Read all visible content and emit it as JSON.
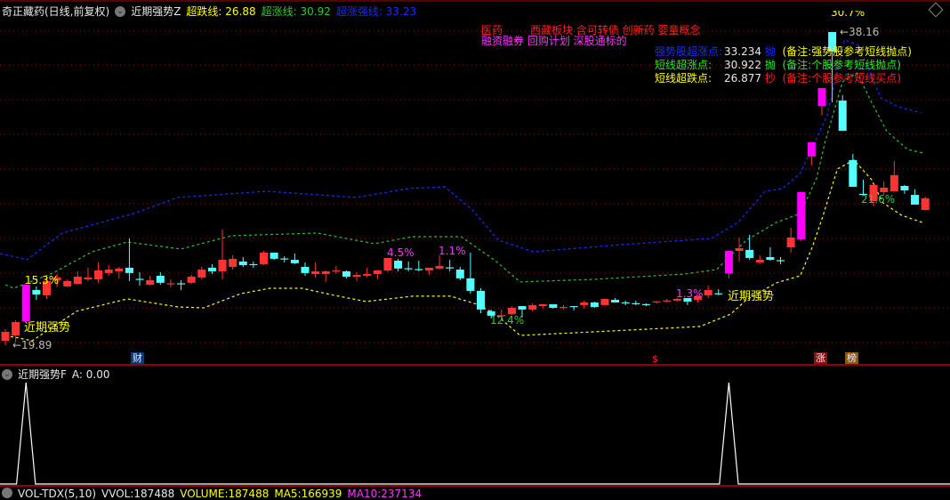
{
  "header": {
    "stock_title": "奇正藏药(日线,前复权)",
    "indicator_name": "近期强势Z",
    "lines": [
      {
        "label": "超跌线:",
        "value": "26.88",
        "color": "#ffff00"
      },
      {
        "label": "超涨线:",
        "value": "30.92",
        "color": "#2ecc2e"
      },
      {
        "label": "超涨强线:",
        "value": "33.23",
        "color": "#1a2cff"
      }
    ]
  },
  "concepts": {
    "line1a": "医药",
    "line1b": "西藏板块 含可转债 创新药 婴童概念",
    "line2": "融资融券 回购计划 深股通标的"
  },
  "legend": [
    {
      "label": "强势股超涨点:",
      "value": "33.234",
      "action": "抛",
      "note": "(备注:强势股参考短线抛点)",
      "label_color": "#1a2cff",
      "action_color": "#1a2cff",
      "note_color": "#ffff00"
    },
    {
      "label": "短线超涨点:",
      "value": "30.922",
      "action": "抛",
      "note": "(备注:个股参考短线抛点)",
      "label_color": "#22ee22",
      "action_color": "#22ee22",
      "note_color": "#22ee22"
    },
    {
      "label": "短线超跌点:",
      "value": "26.877",
      "action": "抄",
      "note": "(备注:个股参考短线买点)",
      "label_color": "#ffff00",
      "action_color": "#ff2020",
      "note_color": "#ff2020"
    }
  ],
  "annotations": {
    "low_price": "←19.89",
    "high_price": "←38.16",
    "pct_15": "15.3%",
    "pct_45": "4.5%",
    "pct_11": "1.1%",
    "pct_124": "12.4%",
    "pct_13": "1.3%",
    "pct_216": "21.6%",
    "pct_307": "30.7%",
    "signal1": "近期强势",
    "signal2": "近期强势"
  },
  "markers": {
    "cai": "财",
    "dollar": "$",
    "zhang": "涨",
    "bang": "榜"
  },
  "lower_pane": {
    "title": "近期强势F",
    "value_text": "A: 0.00"
  },
  "volume_pane": {
    "name": "VOL-TDX(5,10)",
    "vvol": "VVOL:187488",
    "volume": "VOLUME:187488",
    "ma5": "MA5:166939",
    "ma10": "MA10:237134"
  },
  "colors": {
    "up": "#ff3333",
    "down": "#54ffff",
    "strong": "#ff00ff",
    "grid": "#b00000"
  },
  "chart_data": {
    "type": "candlestick",
    "price_range": [
      19.89,
      38.16
    ],
    "candles": [
      [
        20.15,
        20.83,
        19.89,
        20.67
      ],
      [
        20.46,
        21.35,
        20.05,
        21.24
      ],
      [
        21.29,
        23.42,
        21.29,
        23.42,
        "s"
      ],
      [
        23.11,
        23.32,
        22.54,
        22.85
      ],
      [
        22.8,
        23.84,
        22.59,
        23.63
      ],
      [
        23.68,
        24.04,
        23.27,
        23.84
      ],
      [
        23.32,
        23.73,
        23.27,
        23.63
      ],
      [
        23.47,
        24.2,
        23.47,
        23.89
      ],
      [
        23.73,
        24.41,
        23.63,
        23.84
      ],
      [
        23.73,
        24.72,
        23.53,
        24.25
      ],
      [
        24.1,
        24.56,
        23.94,
        24.3
      ],
      [
        24.2,
        24.46,
        23.78,
        24.36
      ],
      [
        24.41,
        26.12,
        23.63,
        24.1
      ],
      [
        23.76,
        24.15,
        23.37,
        23.73
      ],
      [
        23.42,
        23.94,
        23.37,
        23.68
      ],
      [
        23.94,
        24.15,
        23.42,
        23.53
      ],
      [
        23.47,
        23.73,
        23.27,
        23.5
      ],
      [
        23.5,
        23.68,
        23.11,
        23.47
      ],
      [
        23.53,
        23.99,
        23.47,
        23.89
      ],
      [
        23.84,
        24.46,
        23.73,
        24.3
      ],
      [
        24.41,
        24.62,
        24.04,
        24.2
      ],
      [
        24.2,
        26.64,
        23.73,
        24.87
      ],
      [
        24.46,
        25.13,
        24.3,
        24.93
      ],
      [
        24.77,
        25.03,
        24.46,
        24.56
      ],
      [
        24.62,
        24.77,
        24.41,
        24.59
      ],
      [
        24.62,
        25.39,
        24.56,
        25.29
      ],
      [
        25.29,
        25.29,
        24.87,
        24.93
      ],
      [
        24.95,
        25.08,
        24.72,
        24.92
      ],
      [
        24.87,
        25.24,
        24.62,
        24.67
      ],
      [
        24.46,
        24.72,
        23.94,
        24.1
      ],
      [
        24.04,
        24.72,
        23.84,
        24.2
      ],
      [
        24.04,
        24.25,
        23.58,
        24.2
      ],
      [
        24.23,
        24.51,
        24.04,
        24.25
      ],
      [
        24.2,
        24.25,
        23.79,
        23.89
      ],
      [
        23.89,
        24.15,
        23.63,
        23.99
      ],
      [
        23.94,
        24.41,
        23.84,
        24.04
      ],
      [
        24.04,
        24.3,
        23.73,
        24.25
      ],
      [
        24.25,
        24.98,
        24.15,
        24.98
      ],
      [
        24.82,
        24.93,
        24.2,
        24.36
      ],
      [
        24.38,
        24.77,
        24.2,
        24.36
      ],
      [
        24.33,
        24.82,
        24.2,
        24.3
      ],
      [
        24.25,
        24.41,
        24.0,
        24.41
      ],
      [
        24.36,
        25.13,
        24.3,
        24.51
      ],
      [
        24.43,
        24.87,
        24.2,
        24.41
      ],
      [
        24.3,
        24.46,
        23.68,
        23.79
      ],
      [
        23.79,
        25.29,
        22.9,
        23.06
      ],
      [
        23.06,
        23.22,
        21.76,
        21.97
      ],
      [
        21.87,
        21.97,
        21.45,
        21.61
      ],
      [
        21.61,
        21.97,
        21.35,
        21.64
      ],
      [
        21.71,
        22.17,
        21.66,
        22.07
      ],
      [
        22.17,
        22.17,
        21.5,
        21.97
      ],
      [
        21.97,
        22.33,
        21.87,
        22.23
      ],
      [
        22.17,
        22.28,
        22.02,
        22.28
      ],
      [
        22.28,
        22.28,
        22.02,
        22.07
      ],
      [
        22.1,
        22.23,
        21.97,
        22.12
      ],
      [
        22.17,
        22.17,
        21.92,
        22.12
      ],
      [
        22.23,
        22.49,
        22.02,
        22.38
      ],
      [
        22.38,
        22.43,
        22.07,
        22.12
      ],
      [
        22.23,
        22.59,
        22.23,
        22.59
      ],
      [
        22.54,
        22.64,
        22.38,
        22.38
      ],
      [
        22.39,
        22.49,
        22.23,
        22.38
      ],
      [
        22.34,
        22.49,
        22.23,
        22.33
      ],
      [
        22.29,
        22.33,
        22.17,
        22.28
      ],
      [
        22.43,
        22.45,
        22.33,
        22.45
      ],
      [
        22.48,
        22.59,
        22.38,
        22.5
      ],
      [
        22.49,
        22.64,
        22.43,
        22.59
      ],
      [
        22.64,
        22.64,
        22.23,
        22.43
      ],
      [
        22.54,
        22.8,
        22.38,
        22.75
      ],
      [
        22.8,
        23.37,
        22.64,
        23.11
      ],
      [
        22.92,
        23.16,
        22.8,
        22.9
      ],
      [
        24.07,
        25.39,
        23.79,
        25.39,
        "s"
      ],
      [
        25.39,
        26.17,
        24.77,
        25.55
      ],
      [
        25.45,
        26.33,
        24.87,
        24.98
      ],
      [
        24.72,
        25.13,
        24.62,
        24.87
      ],
      [
        25.03,
        25.6,
        24.82,
        24.87
      ],
      [
        24.85,
        25.03,
        24.62,
        24.82
      ],
      [
        25.6,
        26.74,
        25.29,
        26.17
      ],
      [
        26.07,
        28.82,
        25.97,
        28.82,
        "s"
      ],
      [
        30.9,
        31.73,
        30.38,
        31.73,
        "s"
      ],
      [
        33.85,
        34.89,
        33.29,
        34.89,
        "s"
      ],
      [
        38.16,
        38.16,
        34.06,
        37.02
      ],
      [
        34.16,
        34.48,
        32.4,
        32.4
      ],
      [
        30.69,
        31.05,
        29.13,
        29.13
      ],
      [
        28.72,
        29.55,
        28.66,
        28.71
      ],
      [
        28.3,
        29.24,
        27.99,
        29.24
      ],
      [
        28.82,
        29.44,
        28.66,
        29.08
      ],
      [
        28.87,
        30.64,
        28.87,
        29.81
      ],
      [
        29.18,
        29.24,
        28.72,
        28.92
      ],
      [
        28.66,
        28.98,
        28.09,
        28.09
      ],
      [
        27.78,
        28.56,
        27.73,
        28.46
      ]
    ],
    "bands": {
      "strong_overbought": [
        [
          -0.5,
          25.24
        ],
        [
          2.1,
          24.88
        ],
        [
          5.5,
          26.43
        ],
        [
          12.4,
          27.57
        ],
        [
          16.7,
          28.51
        ],
        [
          25.3,
          28.87
        ],
        [
          33.9,
          28.51
        ],
        [
          39.1,
          29.03
        ],
        [
          42.5,
          29.13
        ],
        [
          45.1,
          27.83
        ],
        [
          47.7,
          26.02
        ],
        [
          51.1,
          25.34
        ],
        [
          59.7,
          25.76
        ],
        [
          68.3,
          26.12
        ],
        [
          70.9,
          27.05
        ],
        [
          73.5,
          28.87
        ],
        [
          75.2,
          29.03
        ],
        [
          76.9,
          29.91
        ],
        [
          79.5,
          33.28
        ],
        [
          81.2,
          37.7
        ],
        [
          82.5,
          37.4
        ],
        [
          84.7,
          34.32
        ],
        [
          86.4,
          33.8
        ],
        [
          88.6,
          33.44
        ]
      ],
      "overbought": [
        [
          0,
          23.42
        ],
        [
          0.8,
          23.21
        ],
        [
          4.6,
          24.1
        ],
        [
          8.4,
          25.34
        ],
        [
          11.8,
          25.91
        ],
        [
          17,
          25.5
        ],
        [
          21.9,
          26.28
        ],
        [
          30.2,
          26.43
        ],
        [
          35.7,
          25.81
        ],
        [
          39.4,
          26.22
        ],
        [
          44.1,
          26.22
        ],
        [
          47.4,
          24.82
        ],
        [
          49.8,
          23.58
        ],
        [
          56.9,
          23.73
        ],
        [
          65.7,
          24.04
        ],
        [
          68.8,
          24.3
        ],
        [
          71.7,
          26.02
        ],
        [
          74.6,
          27.05
        ],
        [
          76.9,
          27.57
        ],
        [
          78.5,
          29.65
        ],
        [
          79.3,
          31.73
        ],
        [
          81,
          35.26
        ],
        [
          82.4,
          35.77
        ],
        [
          83.8,
          34.06
        ],
        [
          85.3,
          32.35
        ],
        [
          87.3,
          31.31
        ],
        [
          88.8,
          31.1
        ]
      ],
      "oversold": [
        [
          0,
          20.46
        ],
        [
          2.6,
          20.15
        ],
        [
          6.9,
          21.87
        ],
        [
          11.8,
          22.59
        ],
        [
          16.7,
          22.12
        ],
        [
          19.2,
          22.07
        ],
        [
          22.8,
          22.9
        ],
        [
          25.6,
          23.21
        ],
        [
          28.7,
          23.21
        ],
        [
          31.8,
          22.8
        ],
        [
          34.9,
          22.44
        ],
        [
          39.4,
          22.75
        ],
        [
          43.1,
          22.75
        ],
        [
          45.6,
          22.28
        ],
        [
          47.4,
          21.71
        ],
        [
          49.8,
          20.46
        ],
        [
          56.9,
          20.67
        ],
        [
          67.2,
          20.98
        ],
        [
          70.2,
          21.71
        ],
        [
          71.7,
          22.54
        ],
        [
          74.6,
          23.53
        ],
        [
          76.9,
          23.94
        ],
        [
          78.1,
          25.65
        ],
        [
          79.1,
          27.42
        ],
        [
          80.5,
          30.17
        ],
        [
          82.1,
          30.69
        ],
        [
          83.8,
          29.55
        ],
        [
          84.9,
          28.2
        ],
        [
          86.7,
          27.47
        ],
        [
          88.7,
          27.05
        ]
      ]
    },
    "band_colors": {
      "strong_overbought": "#1a2cff",
      "overbought": "#33bb33",
      "oversold": "#ffff00"
    },
    "signal_indicator_A": {
      "spikes_at_index": [
        2,
        70
      ],
      "value": 1
    }
  }
}
